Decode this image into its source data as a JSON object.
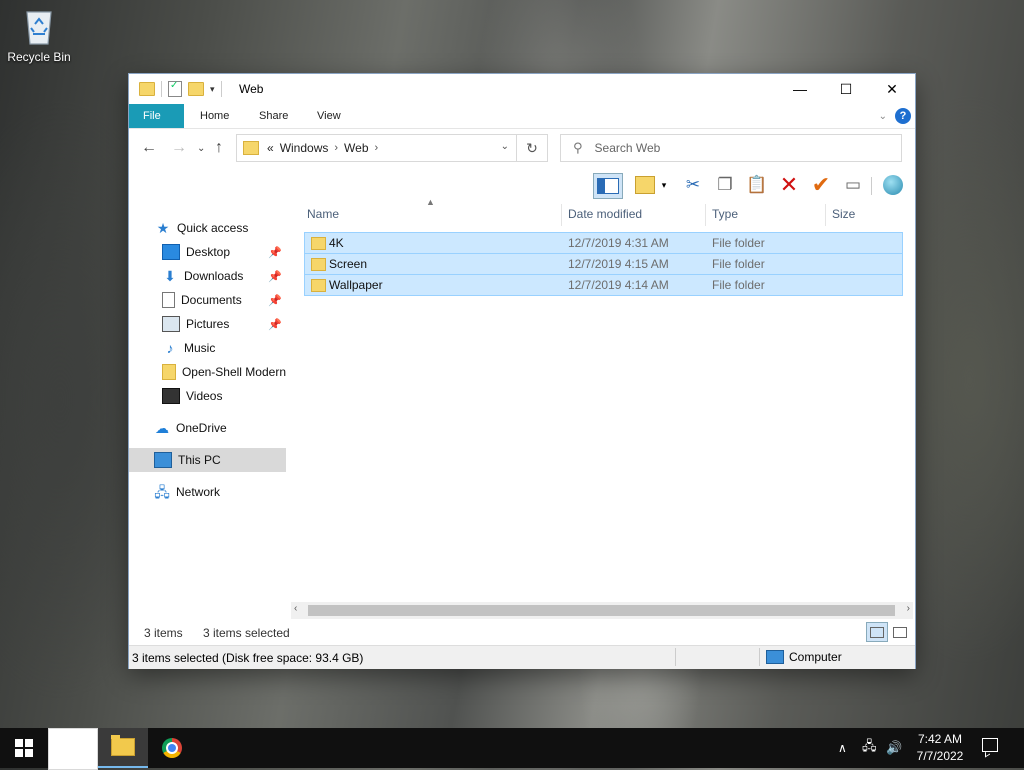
{
  "desktop": {
    "recycle_bin_label": "Recycle Bin"
  },
  "window": {
    "title": "Web",
    "controls": {
      "minimize": "—",
      "maximize": "☐",
      "close": "✕"
    }
  },
  "ribbon": {
    "tabs": [
      "File",
      "Home",
      "Share",
      "View"
    ],
    "accent": "#1a9bb6",
    "help": "?"
  },
  "navigation": {
    "back": "←",
    "forward": "→",
    "recent": "⌄",
    "up": "↑",
    "address_prefix": "«",
    "breadcrumb": [
      "Windows",
      "Web"
    ],
    "search_placeholder": "Search Web"
  },
  "sidebar": {
    "items": [
      {
        "label": "Quick access",
        "icon": "star-icon"
      },
      {
        "label": "Desktop",
        "icon": "desktop-icon",
        "pinned": true
      },
      {
        "label": "Downloads",
        "icon": "downloads-icon",
        "pinned": true
      },
      {
        "label": "Documents",
        "icon": "documents-icon",
        "pinned": true
      },
      {
        "label": "Pictures",
        "icon": "pictures-icon",
        "pinned": true
      },
      {
        "label": "Music",
        "icon": "music-icon"
      },
      {
        "label": "Open-Shell Modern",
        "icon": "folder-icon"
      },
      {
        "label": "Videos",
        "icon": "videos-icon"
      },
      {
        "label": "OneDrive",
        "icon": "cloud-icon"
      },
      {
        "label": "This PC",
        "icon": "computer-icon",
        "selected": true
      },
      {
        "label": "Network",
        "icon": "network-icon"
      }
    ]
  },
  "file_list": {
    "columns": [
      "Name",
      "Date modified",
      "Type",
      "Size"
    ],
    "rows": [
      {
        "name": "4K",
        "date": "12/7/2019 4:31 AM",
        "type": "File folder",
        "size": ""
      },
      {
        "name": "Screen",
        "date": "12/7/2019 4:15 AM",
        "type": "File folder",
        "size": ""
      },
      {
        "name": "Wallpaper",
        "date": "12/7/2019 4:14 AM",
        "type": "File folder",
        "size": ""
      }
    ],
    "selection_color": "#cce8ff"
  },
  "status": {
    "item_count": "3 items",
    "selected_count": "3 items selected",
    "bottom_text": "3 items selected (Disk free space: 93.4 GB)",
    "location": "Computer"
  },
  "taskbar": {
    "time": "7:42 AM",
    "date": "7/7/2022"
  }
}
